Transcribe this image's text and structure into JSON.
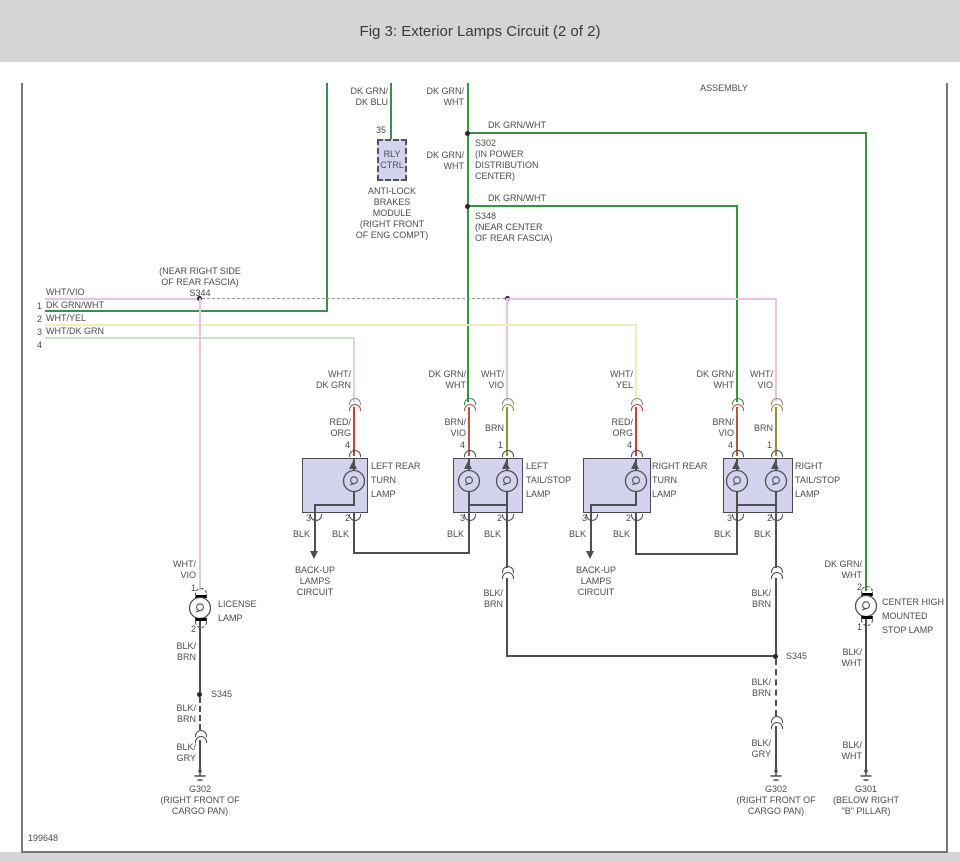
{
  "title": "Fig 3: Exterior Lamps Circuit (2 of 2)",
  "sheet_code": "199648",
  "assembly_label": "ASSEMBLY",
  "module": {
    "name": "RLY\nCTRL",
    "pin": "35",
    "wire": "DK GRN/\nDK BLU",
    "caption": "ANTI-LOCK\nBRAKES\nMODULE\n(RIGHT FRONT\nOF ENG COMPT)"
  },
  "splices": {
    "s302": {
      "id": "S302",
      "loc": "(IN POWER\nDISTRIBUTION\nCENTER)"
    },
    "s348": {
      "id": "S348",
      "loc": "(NEAR CENTER\nOF REAR FASCIA)"
    },
    "s344": {
      "id": "S344",
      "loc": "(NEAR RIGHT SIDE\nOF REAR FASCIA)"
    },
    "s345": {
      "id": "S345"
    }
  },
  "grounds": {
    "g302": {
      "id": "G302",
      "loc": "(RIGHT FRONT OF\nCARGO PAN)"
    },
    "g301": {
      "id": "G301",
      "loc": "(BELOW RIGHT\n\"B\" PILLAR)"
    }
  },
  "pins": {
    "1": "1",
    "2": "2",
    "3": "3",
    "4": "4"
  },
  "wire_labels": {
    "dk_grn_wht": "DK GRN/WHT",
    "dk_grn_wht_2l": "DK GRN/\nWHT",
    "wht_vio": "WHT/VIO",
    "wht_vio_2l": "WHT/\nVIO",
    "wht_yel": "WHT/YEL",
    "wht_yel_2l": "WHT/\nYEL",
    "wht_dk_grn": "WHT/DK GRN",
    "wht_dk_grn_2l": "WHT/\nDK GRN",
    "red_org_2l": "RED/\nORG",
    "brn_vio_2l": "BRN/\nVIO",
    "brn": "BRN",
    "blk": "BLK",
    "blk_brn_2l": "BLK/\nBRN",
    "blk_gry_2l": "BLK/\nGRY",
    "blk_wht_2l": "BLK/\nWHT"
  },
  "lamps": {
    "left_rear_turn": "LEFT REAR\nTURN\nLAMP",
    "left_tail_stop": "LEFT\nTAIL/STOP\nLAMP",
    "right_rear_turn": "RIGHT REAR\nTURN\nLAMP",
    "right_tail_stop": "RIGHT\nTAIL/STOP\nLAMP",
    "license": "LICENSE\nLAMP",
    "center_high_stop": "CENTER HIGH\nMOUNTED\nSTOP LAMP"
  },
  "notes": {
    "backup": "BACK-UP\nLAMPS\nCIRCUIT"
  },
  "colors": {
    "dk_grn": "#3a9043",
    "wht_vio": "#e6c3e3",
    "wht_yel": "#f1ecbb",
    "wht_dk_grn": "#cfe0ca",
    "red_org": "#c04438",
    "brn_vio": "#b2584a",
    "brn": "#9c8b39",
    "blk": "#4f4f4f",
    "box_fill": "#d3d3f0",
    "bg_bar": "#d5d5d5",
    "text": "#4d4d4d"
  }
}
